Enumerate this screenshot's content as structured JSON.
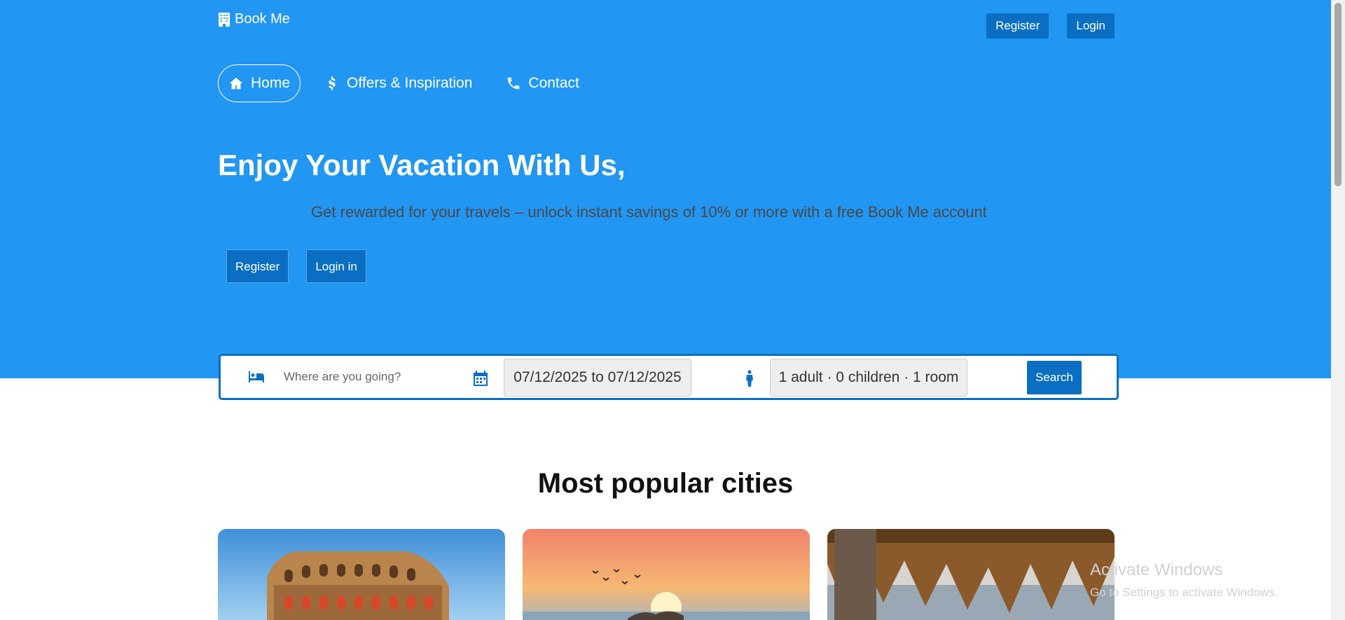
{
  "brand": {
    "name": "Book Me",
    "icon": "hotel-icon"
  },
  "top_nav": {
    "register_label": "Register",
    "login_label": "Login"
  },
  "nav": {
    "items": [
      {
        "label": "Home",
        "icon": "home-icon",
        "active": true
      },
      {
        "label": "Offers & Inspiration",
        "icon": "dollar-icon",
        "active": false
      },
      {
        "label": "Contact",
        "icon": "phone-icon",
        "active": false
      }
    ]
  },
  "hero": {
    "headline": "Enjoy Your Vacation With Us,",
    "subline": "Get rewarded for your travels – unlock instant savings of 10% or more with a free Book Me account",
    "register_label": "Register",
    "login_label": "Login in"
  },
  "search": {
    "destination_placeholder": "Where are you going?",
    "destination_value": "",
    "dates_value": "07/12/2025 to 07/12/2025",
    "guests_value": "1 adult · 0 children · 1 room",
    "button_label": "Search"
  },
  "popular": {
    "title": "Most popular cities"
  },
  "colors": {
    "hero_bg": "#2196f3",
    "accent": "#0a6fc2"
  },
  "os_overlay": {
    "title": "Activate Windows",
    "subtitle": "Go to Settings to activate Windows."
  }
}
